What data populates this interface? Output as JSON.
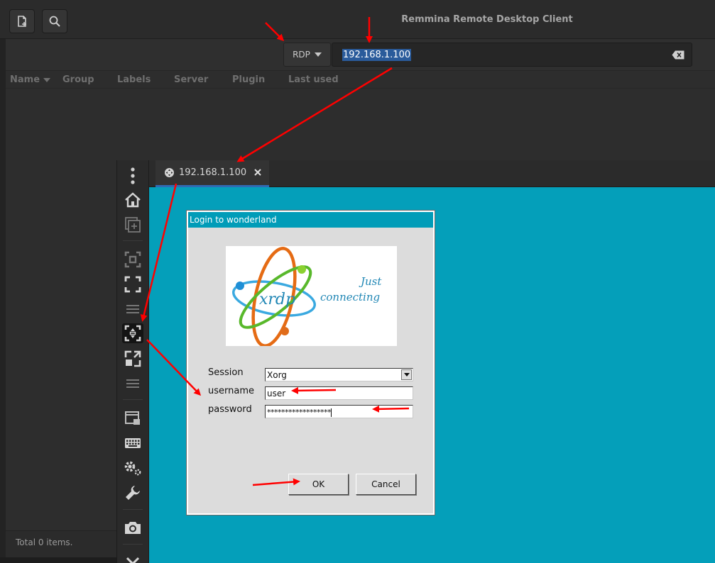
{
  "window": {
    "title": "Remmina Remote Desktop Client"
  },
  "header": {
    "new_connection_icon": "new-file-icon",
    "search_icon": "search-icon"
  },
  "quick_connect": {
    "protocol": "RDP",
    "address": "192.168.1.100"
  },
  "columns": [
    "Name",
    "Group",
    "Labels",
    "Server",
    "Plugin",
    "Last used"
  ],
  "status": {
    "text": "Total 0 items."
  },
  "rdp": {
    "tab_title": "192.168.1.100",
    "sidebar_icons": [
      "menu-dots-icon",
      "home-icon",
      "duplicate-icon",
      "fit-window-icon",
      "fullscreen-icon",
      "menu-lines-icon",
      "scaled-mode-icon",
      "dynamic-resolution-icon",
      "menu-lines-icon",
      "multi-monitor-icon",
      "keyboard-icon",
      "preferences-icon",
      "tools-icon",
      "screenshot-icon",
      "disconnect-icon"
    ]
  },
  "login": {
    "title": "Login to wonderland",
    "logo_word": "xrdp",
    "tagline_1": "Just",
    "tagline_2": "connecting",
    "session_label": "Session",
    "session_value": "Xorg",
    "username_label": "username",
    "username_value": "user",
    "password_label": "password",
    "password_value": "******************",
    "ok": "OK",
    "cancel": "Cancel"
  },
  "colors": {
    "desktop": "#049fba",
    "title_bar": "#009cb8",
    "selection": "#2a5b9b",
    "annotation": "#ff0000"
  }
}
